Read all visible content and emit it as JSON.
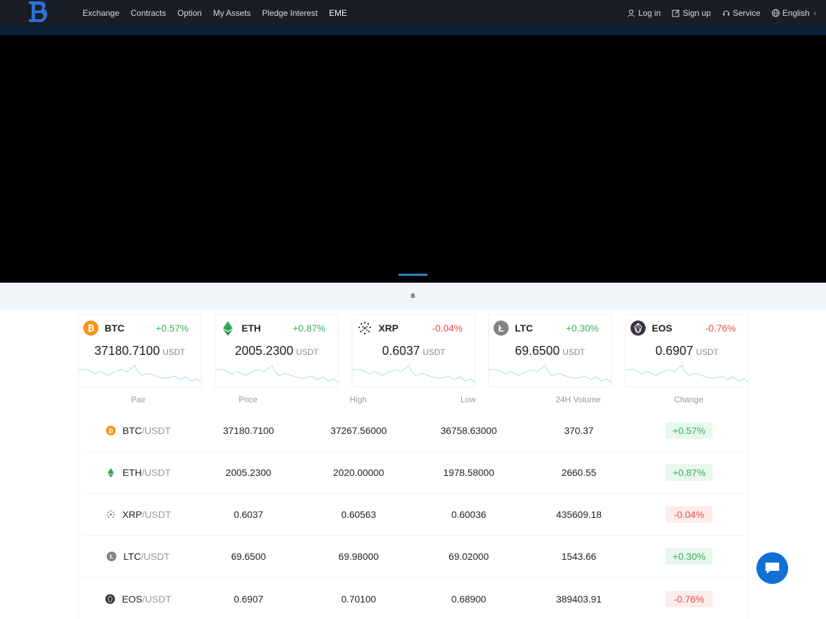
{
  "header": {
    "nav": [
      "Exchange",
      "Contracts",
      "Option",
      "My Assets",
      "Pledge Interest",
      "EME"
    ],
    "right": {
      "login": "Log in",
      "signup": "Sign up",
      "service": "Service",
      "language": "English"
    }
  },
  "notice": {
    "text": "B"
  },
  "colors": {
    "green": "#33b35a",
    "red": "#ef4a48",
    "accent": "#2a86c7",
    "chat": "#1170d6"
  },
  "cards": [
    {
      "symbol": "BTC",
      "change": "+0.57%",
      "price": "37180.7100",
      "unit": "USDT",
      "icon": "btc-icon",
      "trend": "up"
    },
    {
      "symbol": "ETH",
      "change": "+0.87%",
      "price": "2005.2300",
      "unit": "USDT",
      "icon": "eth-icon",
      "trend": "up"
    },
    {
      "symbol": "XRP",
      "change": "-0.04%",
      "price": "0.6037",
      "unit": "USDT",
      "icon": "xrp-icon",
      "trend": "down"
    },
    {
      "symbol": "LTC",
      "change": "+0.30%",
      "price": "69.6500",
      "unit": "USDT",
      "icon": "ltc-icon",
      "trend": "up"
    },
    {
      "symbol": "EOS",
      "change": "-0.76%",
      "price": "0.6907",
      "unit": "USDT",
      "icon": "eos-icon",
      "trend": "down"
    }
  ],
  "table": {
    "headers": [
      "Pair",
      "Price",
      "High",
      "Low",
      "24H Volume",
      "Change"
    ],
    "rows": [
      {
        "base": "BTC",
        "quote": "/USDT",
        "price": "37180.7100",
        "high": "37267.56000",
        "low": "36758.63000",
        "volume": "370.37",
        "change": "+0.57%",
        "trend": "up"
      },
      {
        "base": "ETH",
        "quote": "/USDT",
        "price": "2005.2300",
        "high": "2020.00000",
        "low": "1978.58000",
        "volume": "2660.55",
        "change": "+0.87%",
        "trend": "up"
      },
      {
        "base": "XRP",
        "quote": "/USDT",
        "price": "0.6037",
        "high": "0.60563",
        "low": "0.60036",
        "volume": "435609.18",
        "change": "-0.04%",
        "trend": "down"
      },
      {
        "base": "LTC",
        "quote": "/USDT",
        "price": "69.6500",
        "high": "69.98000",
        "low": "69.02000",
        "volume": "1543.66",
        "change": "+0.30%",
        "trend": "up"
      },
      {
        "base": "EOS",
        "quote": "/USDT",
        "price": "0.6907",
        "high": "0.70100",
        "low": "0.68900",
        "volume": "389403.91",
        "change": "-0.76%",
        "trend": "down"
      }
    ]
  }
}
